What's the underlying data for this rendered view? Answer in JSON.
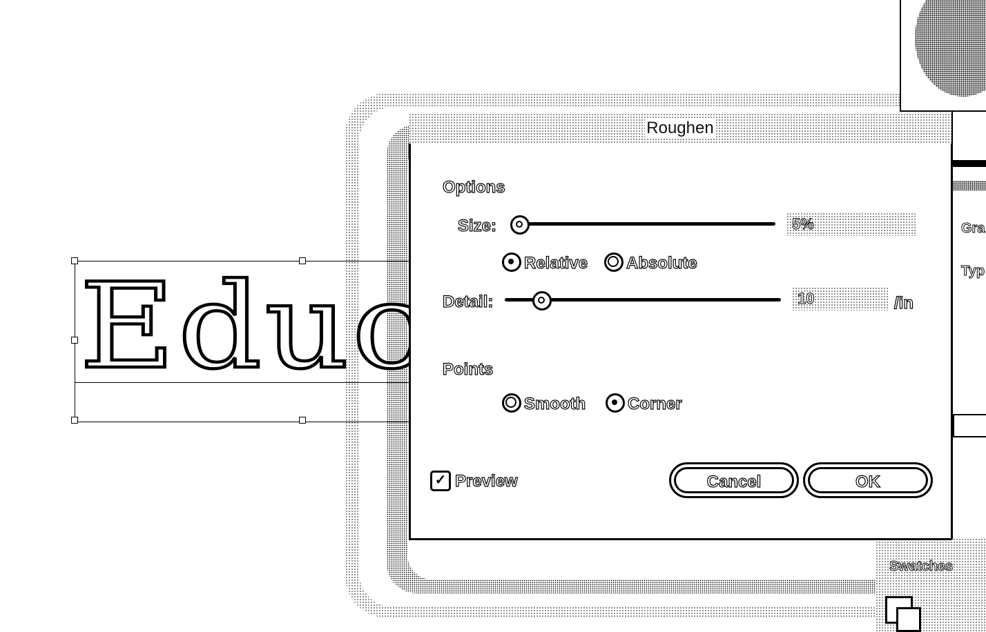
{
  "dialog": {
    "title": "Roughen",
    "options_heading": "Options",
    "size_label": "Size:",
    "size_value": "5%",
    "size_slider_fraction": 0.0,
    "size_mode": {
      "relative_label": "Relative",
      "absolute_label": "Absolute",
      "selected": "Relative"
    },
    "detail_label": "Detail:",
    "detail_value": "10",
    "detail_unit": "/in",
    "detail_slider_fraction": 0.1,
    "points_heading": "Points",
    "points": {
      "smooth_label": "Smooth",
      "corner_label": "Corner",
      "selected": "Corner"
    },
    "preview_label": "Preview",
    "preview_checked": true,
    "cancel_label": "Cancel",
    "ok_label": "OK"
  },
  "canvas": {
    "artwork_text": "Educba"
  },
  "right_panel": {
    "labels": [
      "Gra",
      "Typ"
    ],
    "swatches_label": "Swatches"
  },
  "icons": {
    "checkmark": "check-icon",
    "swatch": "fill-stroke-icon"
  }
}
